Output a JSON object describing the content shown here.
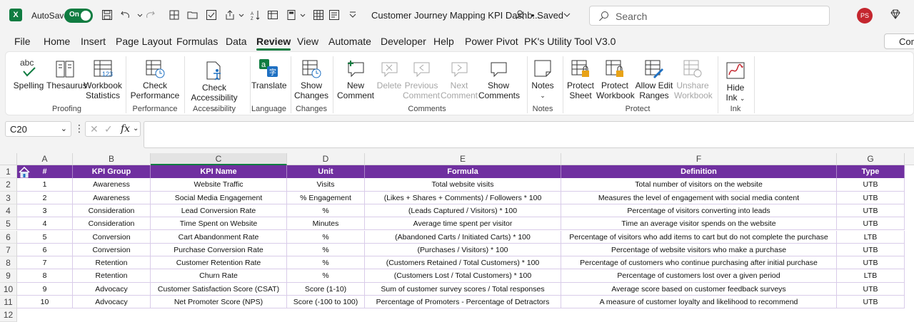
{
  "titlebar": {
    "autosave_label": "AutoSave",
    "autosave_state": "On",
    "document_title": "Customer Journey Mapping KPI Dashb...",
    "saved_status": "• Saved",
    "search_placeholder": "Search",
    "user_initials": "PS"
  },
  "menu": {
    "tabs": [
      "File",
      "Home",
      "Insert",
      "Page Layout",
      "Formulas",
      "Data",
      "Review",
      "View",
      "Automate",
      "Developer",
      "Help",
      "Power Pivot",
      "PK's Utility Tool V3.0"
    ],
    "active_tab": "Review",
    "comments_button": "Com"
  },
  "ribbon": {
    "buttons": {
      "spelling": "Spelling",
      "thesaurus": "Thesaurus",
      "workbook_statistics_1": "Workbook",
      "workbook_statistics_2": "Statistics",
      "check_performance_1": "Check",
      "check_performance_2": "Performance",
      "check_accessibility_1": "Check",
      "check_accessibility_2": "Accessibility",
      "translate": "Translate",
      "show_changes_1": "Show",
      "show_changes_2": "Changes",
      "new_comment_1": "New",
      "new_comment_2": "Comment",
      "delete": "Delete",
      "previous_comment_1": "Previous",
      "previous_comment_2": "Comment",
      "next_comment_1": "Next",
      "next_comment_2": "Comment",
      "show_comments_1": "Show",
      "show_comments_2": "Comments",
      "notes": "Notes",
      "protect_sheet_1": "Protect",
      "protect_sheet_2": "Sheet",
      "protect_workbook_1": "Protect",
      "protect_workbook_2": "Workbook",
      "allow_edit_ranges_1": "Allow Edit",
      "allow_edit_ranges_2": "Ranges",
      "unshare_workbook_1": "Unshare",
      "unshare_workbook_2": "Workbook",
      "hide_ink_1": "Hide",
      "hide_ink_2": "Ink"
    },
    "groups": {
      "proofing": "Proofing",
      "performance": "Performance",
      "accessibility": "Accessibility",
      "language": "Language",
      "changes": "Changes",
      "comments": "Comments",
      "notes": "Notes",
      "protect": "Protect",
      "ink": "Ink"
    },
    "spelling_icon_text": "abc"
  },
  "formula_bar": {
    "name_box": "C20",
    "fx": "fx",
    "formula": ""
  },
  "sheet": {
    "columns": [
      "A",
      "B",
      "C",
      "D",
      "E",
      "F",
      "G"
    ],
    "selected_column": "C",
    "header": [
      "#",
      "KPI Group",
      "KPI Name",
      "Unit",
      "Formula",
      "Definition",
      "Type"
    ],
    "rows": [
      [
        "1",
        "Awareness",
        "Website Traffic",
        "Visits",
        "Total website visits",
        "Total number of visitors on the website",
        "UTB"
      ],
      [
        "2",
        "Awareness",
        "Social Media Engagement",
        "% Engagement",
        "(Likes + Shares + Comments) / Followers * 100",
        "Measures the level of engagement with social media content",
        "UTB"
      ],
      [
        "3",
        "Consideration",
        "Lead Conversion Rate",
        "%",
        "(Leads Captured / Visitors) * 100",
        "Percentage of visitors converting into leads",
        "UTB"
      ],
      [
        "4",
        "Consideration",
        "Time Spent on Website",
        "Minutes",
        "Average time spent per visitor",
        "Time an average visitor spends on the website",
        "UTB"
      ],
      [
        "5",
        "Conversion",
        "Cart Abandonment Rate",
        "%",
        "(Abandoned Carts / Initiated Carts) * 100",
        "Percentage of visitors who add items to cart but do not complete the purchase",
        "LTB"
      ],
      [
        "6",
        "Conversion",
        "Purchase Conversion Rate",
        "%",
        "(Purchases / Visitors) * 100",
        "Percentage of website visitors who make a purchase",
        "UTB"
      ],
      [
        "7",
        "Retention",
        "Customer Retention Rate",
        "%",
        "(Customers Retained / Total Customers) * 100",
        "Percentage of customers who continue purchasing after initial purchase",
        "UTB"
      ],
      [
        "8",
        "Retention",
        "Churn Rate",
        "%",
        "(Customers Lost / Total Customers) * 100",
        "Percentage of customers lost over a given period",
        "LTB"
      ],
      [
        "9",
        "Advocacy",
        "Customer Satisfaction Score (CSAT)",
        "Score (1-10)",
        "Sum of customer survey scores / Total responses",
        "Average score based on customer feedback surveys",
        "UTB"
      ],
      [
        "10",
        "Advocacy",
        "Net Promoter Score (NPS)",
        "Score (-100 to 100)",
        "Percentage of Promoters - Percentage of Detractors",
        "A measure of customer loyalty and likelihood to recommend",
        "UTB"
      ]
    ],
    "row_numbers": [
      "1",
      "2",
      "3",
      "4",
      "5",
      "6",
      "7",
      "8",
      "9",
      "10",
      "11",
      "12"
    ]
  },
  "colors": {
    "accent": "#107c41",
    "header_fill": "#7030a0"
  }
}
